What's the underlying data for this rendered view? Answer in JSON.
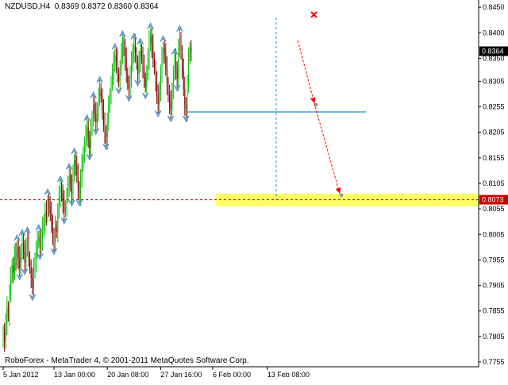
{
  "header": {
    "symbol": "NZDUSD,H4",
    "ohlc": "0.8369 0.8372 0.8360 0.8364"
  },
  "footer": {
    "copyright": "RoboForex - MetaTrader 4, © 2001-2011 MetaQuotes Software Corp."
  },
  "colors": {
    "bull_candle": "#00c000",
    "bear_candle": "#800000",
    "fractal_up": "#6fa8dc",
    "horizontal_line": "#1f8fcf",
    "target_zone": "#ffff66",
    "dashed_level": "#cc0000",
    "arrow": "#ff0000",
    "price_label_bg": "#000000",
    "target_label_bg": "#cc0000"
  },
  "chart_data": {
    "type": "candlestick",
    "title": "NZDUSD,H4",
    "ylim": [
      0.7755,
      0.8455
    ],
    "y_ticks": [
      "0.8450",
      "0.8400",
      "0.8350",
      "0.8305",
      "0.8255",
      "0.8205",
      "0.8155",
      "0.8105",
      "0.8055",
      "0.8005",
      "0.7955",
      "0.7905",
      "0.7855",
      "0.7805",
      "0.7755"
    ],
    "x_ticks": [
      "5 Jan 2012",
      "13 Jan 00:00",
      "20 Jan 08:00",
      "27 Jan 16:00",
      "6 Feb 00:00",
      "13 Feb 08:00"
    ],
    "x_tick_index": [
      0,
      40,
      82,
      124,
      165,
      208
    ],
    "current_price": "0.8364",
    "target_price": "0.8073",
    "support_level": 0.8245,
    "target_zone": [
      0.806,
      0.8085
    ],
    "forecast_path": [
      {
        "index": 232,
        "value": 0.8385
      },
      {
        "index": 245,
        "value": 0.8262
      },
      {
        "index": 265,
        "value": 0.8085
      }
    ],
    "closes": [
      0.7815,
      0.7795,
      0.783,
      0.786,
      0.785,
      0.789,
      0.792,
      0.7945,
      0.793,
      0.7965,
      0.7955,
      0.798,
      0.796,
      0.794,
      0.7975,
      0.799,
      0.797,
      0.795,
      0.7985,
      0.7995,
      0.796,
      0.794,
      0.792,
      0.79,
      0.7935,
      0.7955,
      0.7975,
      0.799,
      0.8,
      0.798,
      0.7995,
      0.8015,
      0.803,
      0.805,
      0.804,
      0.807,
      0.806,
      0.8045,
      0.803,
      0.8,
      0.799,
      0.802,
      0.801,
      0.805,
      0.808,
      0.8095,
      0.8085,
      0.807,
      0.805,
      0.806,
      0.808,
      0.81,
      0.812,
      0.8105,
      0.8085,
      0.812,
      0.815,
      0.814,
      0.812,
      0.8095,
      0.8085,
      0.8115,
      0.814,
      0.8165,
      0.818,
      0.82,
      0.8215,
      0.819,
      0.8175,
      0.821,
      0.8235,
      0.826,
      0.824,
      0.8225,
      0.825,
      0.8275,
      0.829,
      0.8275,
      0.825,
      0.822,
      0.8205,
      0.8195,
      0.8225,
      0.8255,
      0.828,
      0.83,
      0.832,
      0.834,
      0.8355,
      0.8345,
      0.832,
      0.8305,
      0.833,
      0.836,
      0.838,
      0.837,
      0.835,
      0.832,
      0.83,
      0.829,
      0.8315,
      0.834,
      0.8365,
      0.8375,
      0.836,
      0.834,
      0.832,
      0.8345,
      0.8365,
      0.8355,
      0.8335,
      0.831,
      0.8295,
      0.832,
      0.835,
      0.838,
      0.8395,
      0.8375,
      0.835,
      0.833,
      0.8305,
      0.8275,
      0.826,
      0.829,
      0.832,
      0.835,
      0.837,
      0.836,
      0.833,
      0.83,
      0.828,
      0.8265,
      0.825,
      0.829,
      0.832,
      0.8345,
      0.833,
      0.831,
      0.837,
      0.839,
      0.836,
      0.833,
      0.829,
      0.826,
      0.825,
      0.83,
      0.835,
      0.837,
      0.8364
    ]
  }
}
